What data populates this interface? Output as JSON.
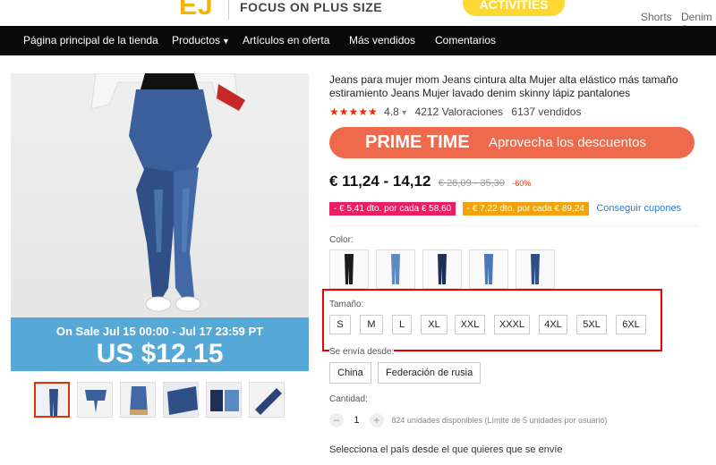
{
  "header": {
    "logo_text": "EJ",
    "slogan": "FOCUS ON PLUS SIZE",
    "activities_label": "ACTIVITIES",
    "links": [
      "Shorts",
      "Denim S"
    ]
  },
  "nav": {
    "items": [
      "Página principal de la tienda",
      "Productos",
      "Artículos en oferta",
      "Más vendidos",
      "Comentarios"
    ]
  },
  "gallery": {
    "promo_line1": "On Sale Jul 15 00:00 - Jul 17 23:59 PT",
    "promo_line2": "US $12.15",
    "thumbnail_count": 6,
    "active_thumbnail": 1
  },
  "product": {
    "title": "Jeans para mujer mom Jeans cintura alta Mujer alta elástico más tamaño estiramiento Jeans Mujer lavado denim skinny lápiz pantalones",
    "stars": "★★★★★",
    "rating": "4.8",
    "rating_caret": "▾",
    "reviews": "4212 Valoraciones",
    "sold": "6137 vendidos",
    "prime_title": "PRIME TIME",
    "prime_subtitle": "Aprovecha los descuentos",
    "price": "€ 11,24 - 14,12",
    "original_price": "€ 28,09 - 35,30",
    "discount": "-60%",
    "coupon1": "- € 5,41 dto. por cada € 58,60",
    "coupon2": "- € 7,22 dto. por cada € 89,24",
    "coupon_link": "Conseguir cupones"
  },
  "color": {
    "label": "Color:",
    "swatch_count": 5
  },
  "size": {
    "label": "Tamaño:",
    "options": [
      "S",
      "M",
      "L",
      "XL",
      "XXL",
      "XXXL",
      "4XL",
      "5XL",
      "6XL"
    ]
  },
  "ship_from": {
    "label": "Se envía desde:",
    "options": [
      "China",
      "Federación de rusia"
    ]
  },
  "quantity": {
    "label": "Cantidad:",
    "minus": "−",
    "value": "1",
    "plus": "+",
    "available": "824 unidades disponibles (Límite de 5 unidades por usuario)"
  },
  "ship_country": "Selecciona el país desde el que quieres que se envíe",
  "colors": {
    "nav_bg": "#0a0a0a",
    "accent_red": "#e62e04",
    "prime_orange": "#ef6a4c",
    "promo_blue": "#56a9d6",
    "denim_dark": "#2f4f86",
    "denim_light": "#5e8ac4"
  }
}
